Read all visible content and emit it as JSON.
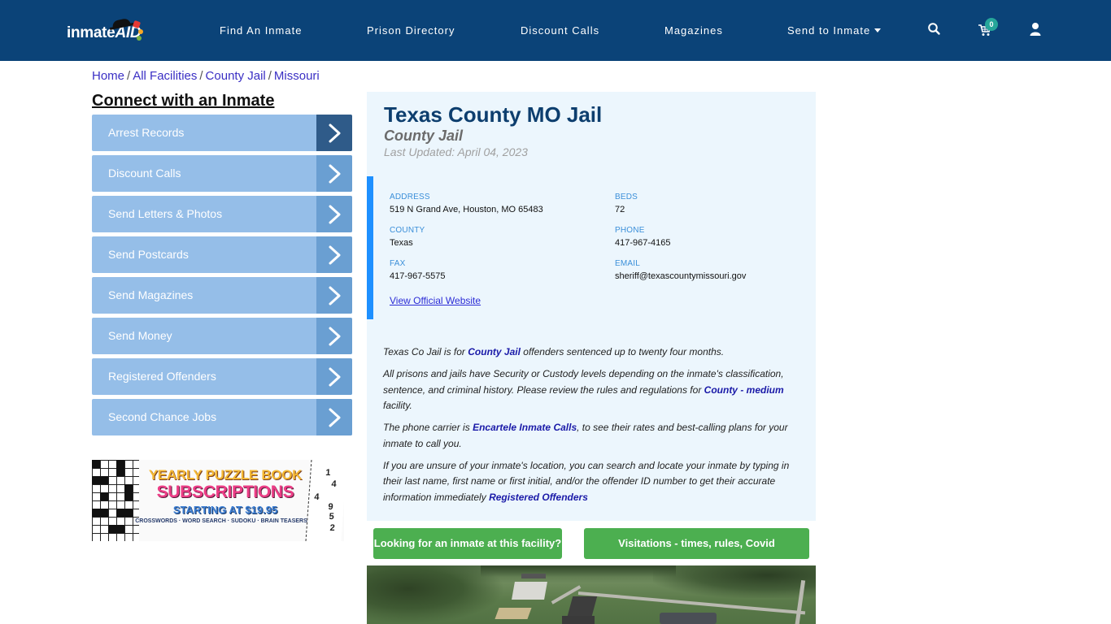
{
  "header": {
    "logo_text": "inmate",
    "logo_accent": "AID",
    "nav": [
      {
        "label": "Find An Inmate"
      },
      {
        "label": "Prison Directory"
      },
      {
        "label": "Discount Calls"
      },
      {
        "label": "Magazines"
      },
      {
        "label": "Send to Inmate",
        "has_dropdown": true
      }
    ],
    "icons": [
      "search-icon",
      "cart-icon",
      "user-icon"
    ],
    "cart_count": "0",
    "colors": {
      "bar": "#0b4378",
      "badge": "#26a69a"
    }
  },
  "breadcrumb": {
    "items": [
      "Home",
      "All Facilities",
      "County Jail",
      "Missouri"
    ],
    "separator": "/"
  },
  "sidebar": {
    "title": "Connect with an Inmate",
    "items": [
      {
        "label": "Arrest Records",
        "active": true
      },
      {
        "label": "Discount Calls"
      },
      {
        "label": "Send Letters & Photos"
      },
      {
        "label": "Send Postcards"
      },
      {
        "label": "Send Magazines"
      },
      {
        "label": "Send Money"
      },
      {
        "label": "Registered Offenders"
      },
      {
        "label": "Second Chance Jobs"
      }
    ],
    "ad": {
      "line1": "YEARLY PUZZLE BOOK",
      "line2": "SUBSCRIPTIONS",
      "line3": "STARTING AT $19.95",
      "line4": "CROSSWORDS · WORD SEARCH · SUDOKU · BRAIN TEASERS",
      "sudoku_digits": [
        "1",
        "4",
        "4",
        "9",
        "5",
        "2"
      ]
    }
  },
  "facility": {
    "name": "Texas County MO Jail",
    "type": "County Jail",
    "last_updated": "Last Updated: April 04, 2023",
    "fields": {
      "address": {
        "label": "ADDRESS",
        "value": "519 N Grand Ave, Houston, MO 65483"
      },
      "beds": {
        "label": "BEDS",
        "value": "72"
      },
      "county": {
        "label": "COUNTY",
        "value": "Texas"
      },
      "phone": {
        "label": "PHONE",
        "value": "417-967-4165"
      },
      "fax": {
        "label": "FAX",
        "value": "417-967-5575"
      },
      "email": {
        "label": "EMAIL",
        "value": "sheriff@texascountymissouri.gov"
      }
    },
    "website_link": "View Official Website",
    "description": {
      "p1": {
        "before": "Texas Co Jail is for ",
        "link": "County Jail",
        "after": " offenders sentenced up to twenty four months."
      },
      "p2": {
        "before": "All prisons and jails have Security or Custody levels depending on the inmate's classification, sentence, and criminal history. Please review the rules and regulations for ",
        "link": "County - medium",
        "after": " facility."
      },
      "p3": {
        "before": "The phone carrier is ",
        "link": "Encartele Inmate Calls",
        "after": ", to see their rates and best-calling plans for your inmate to call you."
      },
      "p4": {
        "before": "If you are unsure of your inmate's location, you can search and locate your inmate by typing in their last name, first name or first initial, and/or the offender ID number to get their accurate information immediately ",
        "link": "Registered Offenders",
        "after": ""
      }
    },
    "buttons": {
      "find_inmate": "Looking for an inmate at this facility?",
      "visitation": "Visitations - times, rules, Covid cancellations"
    },
    "colors": {
      "title": "#0d3e6e",
      "panel_bg": "#ecf6fd",
      "accent_bar": "#1e90ff",
      "button": "#4caf50"
    }
  }
}
